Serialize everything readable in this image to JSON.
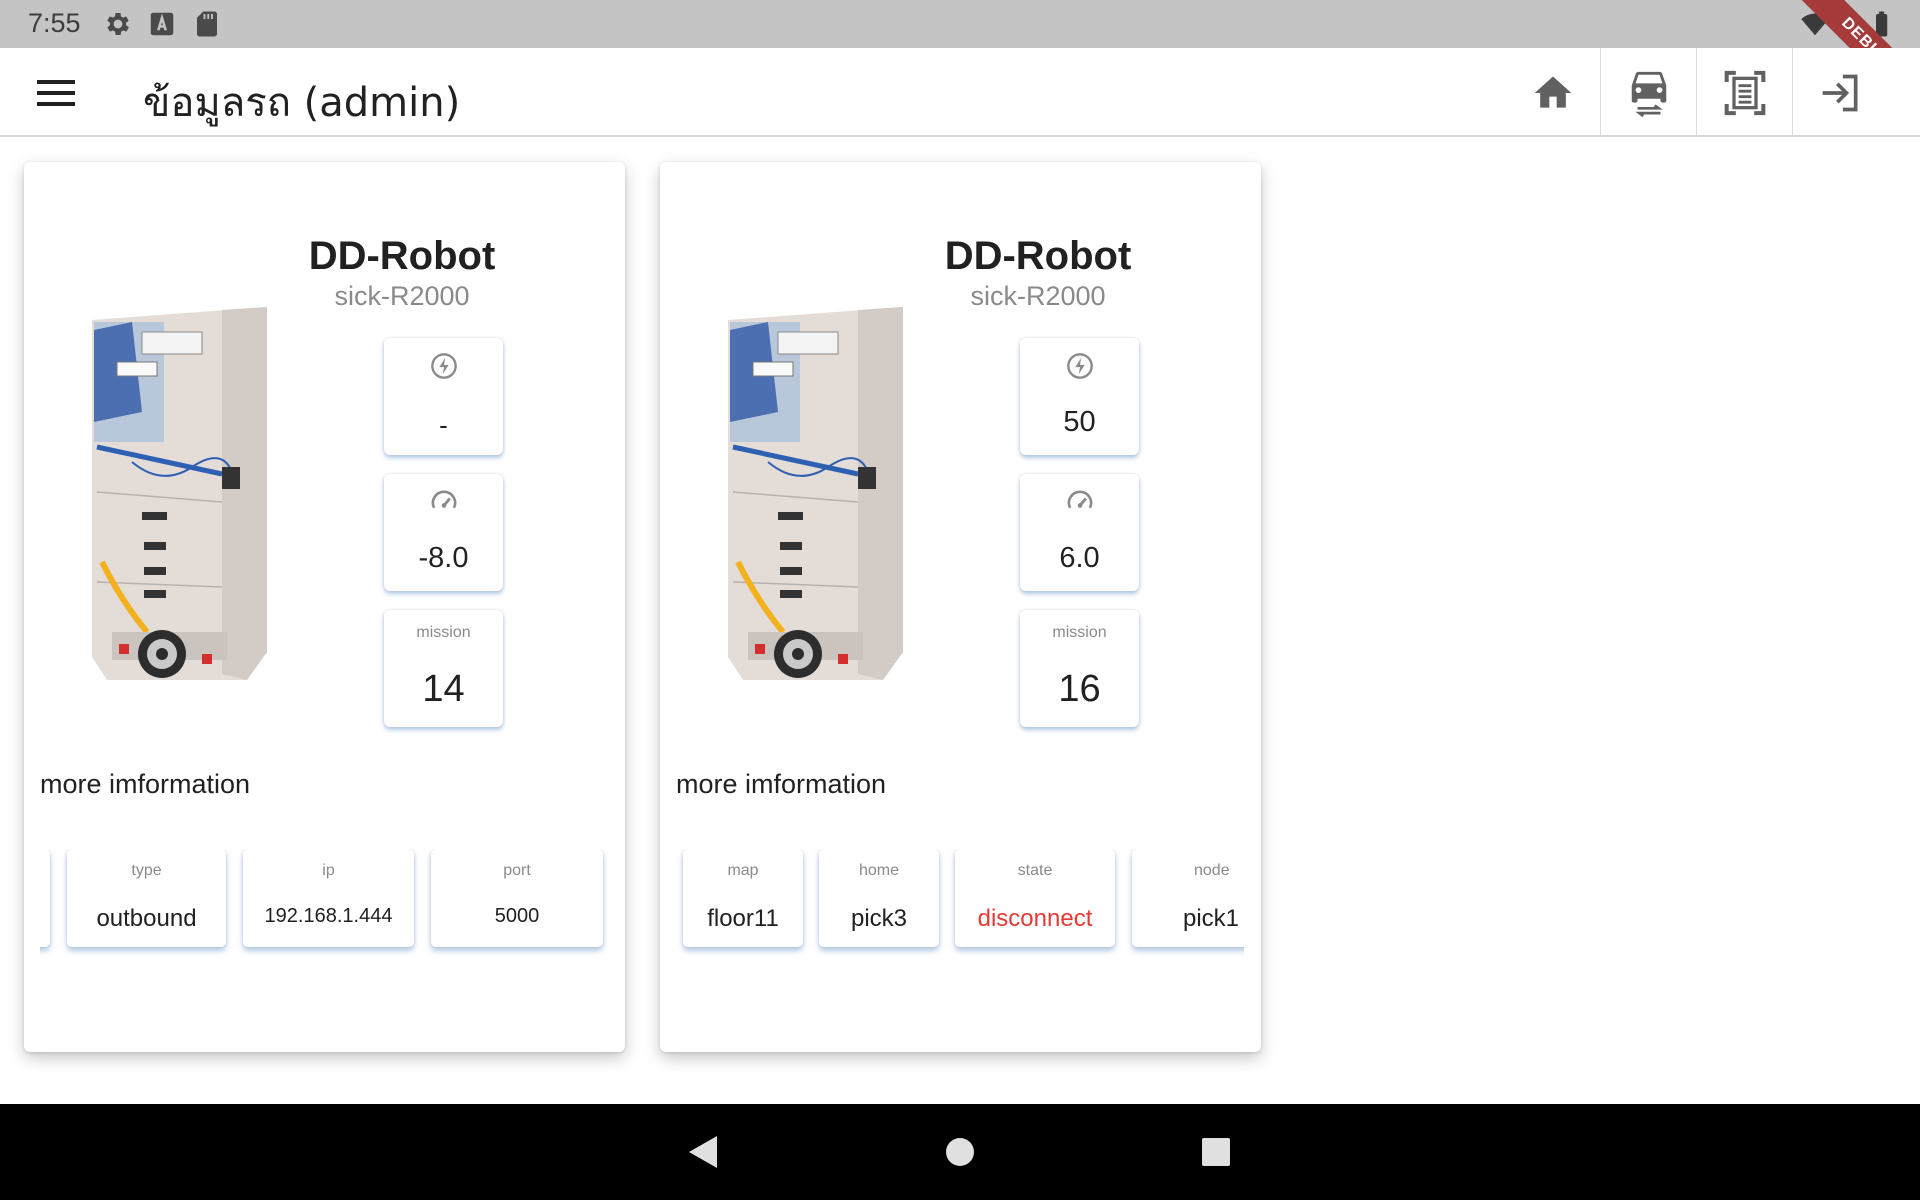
{
  "status_bar": {
    "time": "7:55",
    "icons": [
      "gear-icon",
      "font-a-icon",
      "sd-card-icon",
      "wifi-icon",
      "battery-icon"
    ],
    "debug_label": "DEBUG"
  },
  "app_bar": {
    "title": "ข้อมูลรถ (admin)",
    "menu_icon": "hamburger-menu-icon",
    "actions": [
      {
        "name": "home-icon"
      },
      {
        "name": "vehicle-swap-icon"
      },
      {
        "name": "document-scan-icon"
      },
      {
        "name": "login-icon"
      }
    ]
  },
  "colors": {
    "error_red": "#e53935",
    "accent_blue": "#78a0d2",
    "status_bar_gray": "#c4c4c4"
  },
  "robots": [
    {
      "name": "DD-Robot",
      "model": "sick-R2000",
      "battery": "-",
      "speed": "-8.0",
      "mission_label": "mission",
      "mission": "14",
      "more_info_label": "more imformation",
      "info": [
        {
          "label": "",
          "value": ""
        },
        {
          "label": "type",
          "value": "outbound"
        },
        {
          "label": "ip",
          "value": "192.168.1.444"
        },
        {
          "label": "port",
          "value": "5000"
        }
      ]
    },
    {
      "name": "DD-Robot",
      "model": "sick-R2000",
      "battery": "50",
      "speed": "6.0",
      "mission_label": "mission",
      "mission": "16",
      "more_info_label": "more imformation",
      "info": [
        {
          "label": "map",
          "value": "floor11"
        },
        {
          "label": "home",
          "value": "pick3"
        },
        {
          "label": "state",
          "value": "disconnect"
        },
        {
          "label": "node",
          "value": "pick1"
        }
      ]
    }
  ],
  "nav_bar": {
    "buttons": [
      "back-icon",
      "home-circle-icon",
      "recents-icon"
    ]
  }
}
